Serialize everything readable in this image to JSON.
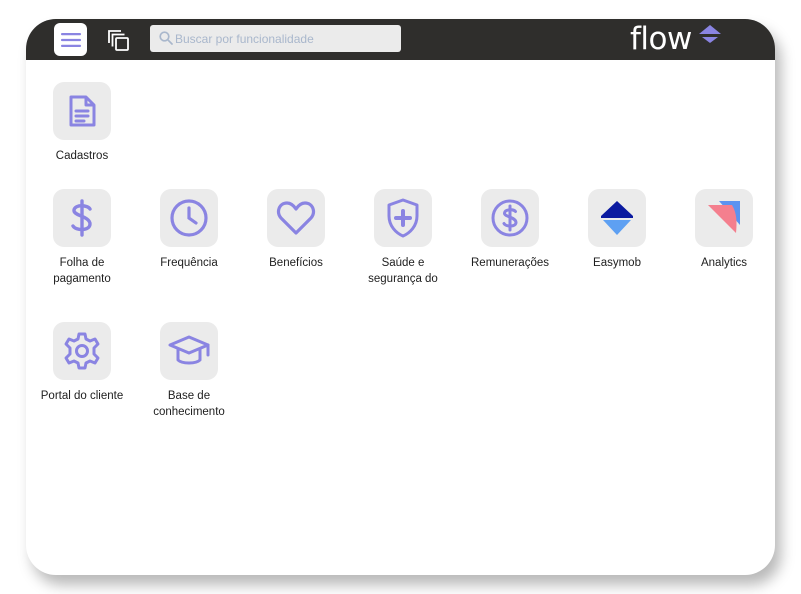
{
  "header": {
    "search_placeholder": "Buscar por funcionalidade",
    "logo_text": "flow"
  },
  "modules": {
    "cadastros": "Cadastros",
    "folha": "Folha de pagamento",
    "frequencia": "Frequência",
    "beneficios": "Benefícios",
    "saude": "Saúde e segurança do trabalho",
    "remuneracoes": "Remunerações",
    "easymob": "Easymob",
    "analytics": "Analytics",
    "portal": "Portal do cliente",
    "base": "Base de conhecimento"
  },
  "colors": {
    "topbar": "#2f2e2c",
    "icon_accent": "#8a84e2",
    "tile_bg": "#ebebeb",
    "easymob_top": "#0b1aa0",
    "easymob_bottom": "#5ea0f2",
    "analytics_pink": "#f47f8e",
    "analytics_blue": "#5b93f0"
  }
}
